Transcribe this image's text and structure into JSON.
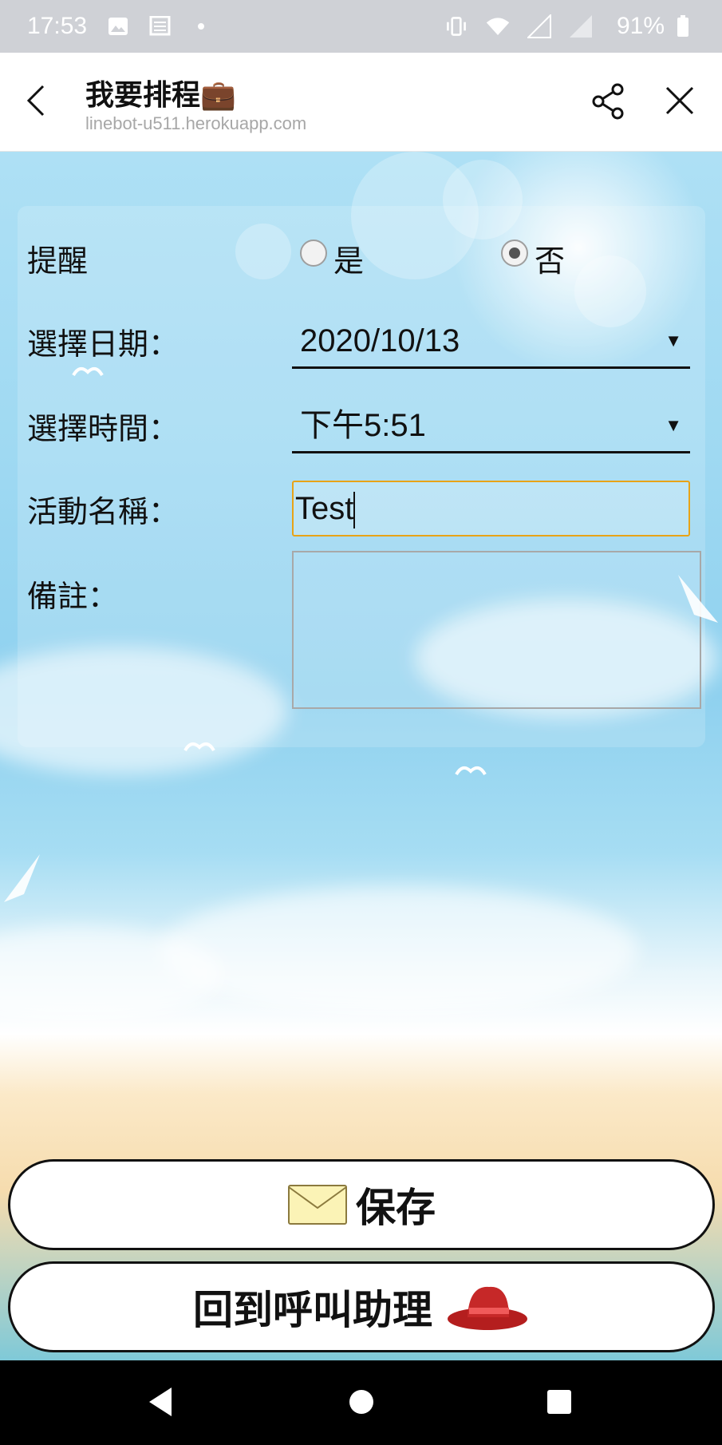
{
  "status_bar": {
    "time": "17:53",
    "battery": "91%",
    "icons": [
      "image-icon",
      "news-icon",
      "dot-icon",
      "vibrate-icon",
      "wifi-icon",
      "signal-icon",
      "signal-icon",
      "battery-icon"
    ]
  },
  "header": {
    "title": "我要排程💼",
    "url": "linebot-u511.herokuapp.com"
  },
  "form": {
    "reminder": {
      "label": "提醒",
      "options": [
        "是",
        "否"
      ],
      "selected": "否"
    },
    "date": {
      "label": "選擇日期：",
      "value": "2020/10/13"
    },
    "time": {
      "label": "選擇時間：",
      "value": "下午5:51"
    },
    "event_name": {
      "label": "活動名稱：",
      "value": "Test"
    },
    "notes": {
      "label": "備註：",
      "value": ""
    }
  },
  "buttons": {
    "save_label": "保存",
    "back_label": "回到呼叫助理"
  },
  "colors": {
    "input_focus_border": "#e8a317",
    "status_bar_bg": "#cfd1d6"
  }
}
